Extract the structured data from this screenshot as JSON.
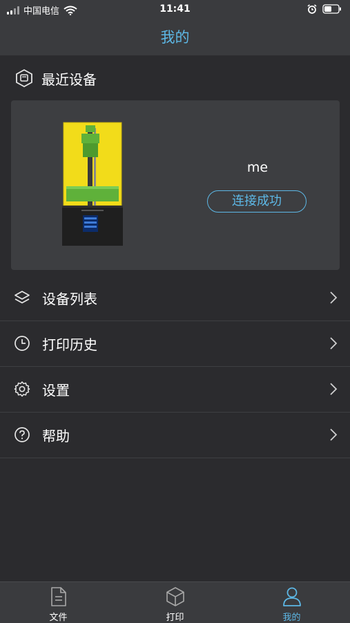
{
  "status_bar": {
    "carrier": "中国电信",
    "time": "11:41"
  },
  "nav": {
    "title": "我的"
  },
  "recent": {
    "header": "最近设备",
    "device": {
      "name": "me",
      "status": "连接成功"
    }
  },
  "menu": {
    "items": [
      {
        "label": "设备列表",
        "icon": "layers-icon"
      },
      {
        "label": "打印历史",
        "icon": "clock-icon"
      },
      {
        "label": "设置",
        "icon": "gear-icon"
      },
      {
        "label": "帮助",
        "icon": "help-circle-icon"
      }
    ]
  },
  "tabs": [
    {
      "label": "文件",
      "icon": "document-icon",
      "active": false
    },
    {
      "label": "打印",
      "icon": "cube-icon",
      "active": false
    },
    {
      "label": "我的",
      "icon": "person-icon",
      "active": true
    }
  ],
  "colors": {
    "accent": "#5db8e6",
    "background": "#2b2b2e",
    "bar": "#3a3b3e",
    "card": "#3d3e41"
  }
}
